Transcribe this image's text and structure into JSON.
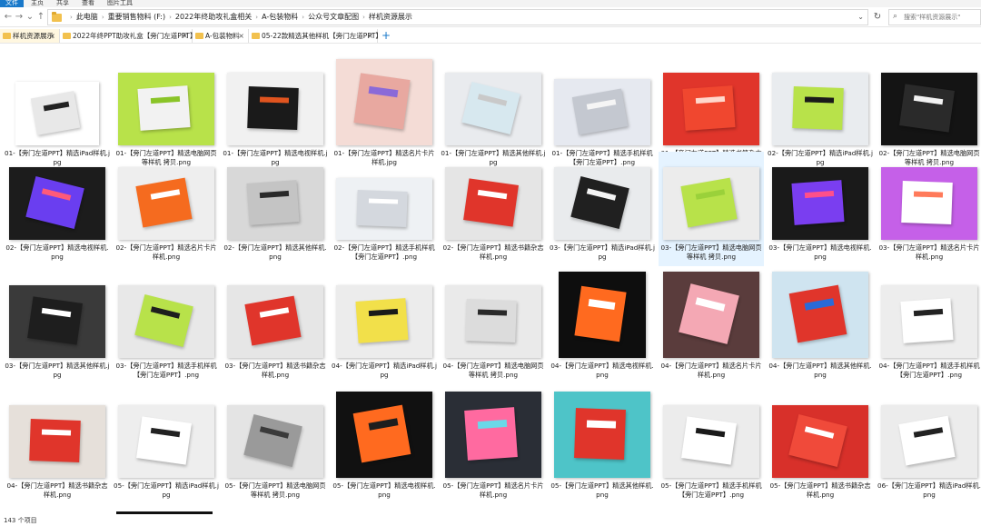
{
  "ribbon": {
    "tabs": [
      "文件",
      "主页",
      "共享",
      "查看",
      "图片工具"
    ]
  },
  "address": {
    "crumbs": [
      "此电脑",
      "重要销售物料 (F:)",
      "2022年终助攻礼盒相关",
      "A-包装物料",
      "公众号文章配图",
      "样机资源展示"
    ],
    "nav_back": "←",
    "nav_forward": "→",
    "nav_recent": "⌄",
    "nav_up": "↑",
    "dropdown": "⌄",
    "refresh": "↻"
  },
  "search": {
    "placeholder": "搜索\"样机资源展示\"",
    "value": ""
  },
  "tabs": [
    {
      "label": "样机资源展示",
      "close": "×"
    },
    {
      "label": "2022年终PPT助攻礼盒【旁门左道PPT】",
      "close": "×"
    },
    {
      "label": "A-包装物料",
      "close": "×"
    },
    {
      "label": "05-22款精选其他样机【旁门左道PPT】",
      "close": "×"
    }
  ],
  "tab_add": "+",
  "files": [
    {
      "name": "01-【旁门左道PPT】精选iPad样机.jpg",
      "bg": "#ffffff",
      "a": "#e8e8e8",
      "b": "#222222",
      "w": 92,
      "h": 70,
      "sel": false
    },
    {
      "name": "01-【旁门左道PPT】精选电脑网页等样机 拷贝.png",
      "bg": "#b8e24a",
      "a": "#f2f2f2",
      "b": "#8ac428",
      "w": 106,
      "h": 80,
      "sel": false
    },
    {
      "name": "01-【旁门左道PPT】精选电视样机.jpg",
      "bg": "#f1f1f1",
      "a": "#1a1a1a",
      "b": "#e0541f",
      "w": 106,
      "h": 80,
      "sel": false
    },
    {
      "name": "01-【旁门左道PPT】精选名片卡片样机.jpg",
      "bg": "#f4dcd6",
      "a": "#e8a8a0",
      "b": "#8a6ad8",
      "w": 106,
      "h": 95,
      "sel": false
    },
    {
      "name": "01-【旁门左道PPT】精选其他样机.jpg",
      "bg": "#e9ebee",
      "a": "#d7e8ef",
      "b": "#c9c9c9",
      "w": 106,
      "h": 80,
      "sel": false
    },
    {
      "name": "01-【旁门左道PPT】精选手机样机【旁门左道PPT】.png",
      "bg": "#e6e9f0",
      "a": "#c4c8d0",
      "b": "#f5f5f5",
      "w": 106,
      "h": 73,
      "sel": false
    },
    {
      "name": "01-【旁门左道PPT】精选书籍杂志样机.png",
      "bg": "#e0352b",
      "a": "#f0472f",
      "b": "#ffd8cc",
      "w": 106,
      "h": 80,
      "sel": false
    },
    {
      "name": "02-【旁门左道PPT】精选iPad样机.jpg",
      "bg": "#e9ecef",
      "a": "#b8e24a",
      "b": "#1a1a1a",
      "w": 106,
      "h": 80,
      "sel": false
    },
    {
      "name": "02-【旁门左道PPT】精选电脑网页等样机 拷贝.png",
      "bg": "#141414",
      "a": "#2a2a2a",
      "b": "#f2f2f2",
      "w": 106,
      "h": 80,
      "sel": false
    },
    {
      "name": "02-【旁门左道PPT】精选电视样机.png",
      "bg": "#1c1c1c",
      "a": "#6a3ef0",
      "b": "#ff5a7a",
      "w": 106,
      "h": 80,
      "sel": false
    },
    {
      "name": "02-【旁门左道PPT】精选名片卡片样机.png",
      "bg": "#eeeeee",
      "a": "#f56b1f",
      "b": "#ffffff",
      "w": 106,
      "h": 80,
      "sel": false
    },
    {
      "name": "02-【旁门左道PPT】精选其他样机.png",
      "bg": "#d8d8d8",
      "a": "#c4c4c4",
      "b": "#2a2a2a",
      "w": 106,
      "h": 80,
      "sel": false
    },
    {
      "name": "02-【旁门左道PPT】精选手机样机【旁门左道PPT】.png",
      "bg": "#eef1f4",
      "a": "#d4d8de",
      "b": "#ffffff",
      "w": 106,
      "h": 68,
      "sel": false
    },
    {
      "name": "02-【旁门左道PPT】精选书籍杂志样机.png",
      "bg": "#e5e5e5",
      "a": "#e0352b",
      "b": "#ffffff",
      "w": 106,
      "h": 80,
      "sel": false
    },
    {
      "name": "03-【旁门左道PPT】精选iPad样机.jpg",
      "bg": "#e9ebed",
      "a": "#202020",
      "b": "#f4f4f4",
      "w": 106,
      "h": 80,
      "sel": false
    },
    {
      "name": "03-【旁门左道PPT】精选电脑网页等样机 拷贝.png",
      "bg": "#ececec",
      "a": "#b8e24a",
      "b": "#9ad13a",
      "w": 106,
      "h": 80,
      "sel": true
    },
    {
      "name": "03-【旁门左道PPT】精选电视样机.png",
      "bg": "#1a1a1a",
      "a": "#7a3ef0",
      "b": "#ff4f8a",
      "w": 106,
      "h": 80,
      "sel": false
    },
    {
      "name": "03-【旁门左道PPT】精选名片卡片样机.png",
      "bg": "#c560e8",
      "a": "#ffffff",
      "b": "#ff7a5a",
      "w": 106,
      "h": 80,
      "sel": false
    },
    {
      "name": "03-【旁门左道PPT】精选其他样机.jpg",
      "bg": "#3a3a3a",
      "a": "#1e1e1e",
      "b": "#ffffff",
      "w": 106,
      "h": 80,
      "sel": false
    },
    {
      "name": "03-【旁门左道PPT】精选手机样机【旁门左道PPT】.png",
      "bg": "#e8e8e8",
      "a": "#b8e24a",
      "b": "#1e1e1e",
      "w": 106,
      "h": 80,
      "sel": false
    },
    {
      "name": "03-【旁门左道PPT】精选书籍杂志样机.png",
      "bg": "#e6e6e6",
      "a": "#e0352b",
      "b": "#ffffff",
      "w": 106,
      "h": 80,
      "sel": false
    },
    {
      "name": "04-【旁门左道PPT】精选iPad样机.jpg",
      "bg": "#ececec",
      "a": "#f2e04a",
      "b": "#1a1a1a",
      "w": 106,
      "h": 80,
      "sel": false
    },
    {
      "name": "04-【旁门左道PPT】精选电脑网页等样机 拷贝.png",
      "bg": "#eaeaea",
      "a": "#dcdcdc",
      "b": "#2a2a2a",
      "w": 106,
      "h": 80,
      "sel": false
    },
    {
      "name": "04-【旁门左道PPT】精选电视样机.png",
      "bg": "#0e0e0e",
      "a": "#ff6a1f",
      "b": "#ffffff",
      "w": 96,
      "h": 95,
      "sel": false
    },
    {
      "name": "04-【旁门左道PPT】精选名片卡片样机.png",
      "bg": "#5a3c3c",
      "a": "#f4a8b4",
      "b": "#ffffff",
      "w": 106,
      "h": 95,
      "sel": false
    },
    {
      "name": "04-【旁门左道PPT】精选其他样机.png",
      "bg": "#cfe4f0",
      "a": "#e0352b",
      "b": "#2a6ad8",
      "w": 106,
      "h": 95,
      "sel": false
    },
    {
      "name": "04-【旁门左道PPT】精选手机样机【旁门左道PPT】.png",
      "bg": "#ededed",
      "a": "#ffffff",
      "b": "#222222",
      "w": 106,
      "h": 80,
      "sel": false
    },
    {
      "name": "04-【旁门左道PPT】精选书籍杂志样机.png",
      "bg": "#e6e0da",
      "a": "#e0352b",
      "b": "#ffffff",
      "w": 106,
      "h": 80,
      "sel": false
    },
    {
      "name": "05-【旁门左道PPT】精选iPad样机.jpg",
      "bg": "#eeeeee",
      "a": "#ffffff",
      "b": "#222222",
      "w": 106,
      "h": 80,
      "sel": false
    },
    {
      "name": "05-【旁门左道PPT】精选电脑网页等样机 拷贝.png",
      "bg": "#e4e4e4",
      "a": "#9a9a9a",
      "b": "#3a3a3a",
      "w": 106,
      "h": 80,
      "sel": false
    },
    {
      "name": "05-【旁门左道PPT】精选电视样机.png",
      "bg": "#111111",
      "a": "#ff6a1f",
      "b": "#1e1e1e",
      "w": 106,
      "h": 95,
      "sel": false
    },
    {
      "name": "05-【旁门左道PPT】精选名片卡片样机.png",
      "bg": "#2a2e36",
      "a": "#ff6aa0",
      "b": "#6ad8e8",
      "w": 106,
      "h": 95,
      "sel": false
    },
    {
      "name": "05-【旁门左道PPT】精选其他样机.png",
      "bg": "#4ec4c8",
      "a": "#e0352b",
      "b": "#ffffff",
      "w": 106,
      "h": 95,
      "sel": false
    },
    {
      "name": "05-【旁门左道PPT】精选手机样机【旁门左道PPT】.png",
      "bg": "#ececec",
      "a": "#ffffff",
      "b": "#1a1a1a",
      "w": 106,
      "h": 80,
      "sel": false
    },
    {
      "name": "05-【旁门左道PPT】精选书籍杂志样机.png",
      "bg": "#d8302a",
      "a": "#f04a3a",
      "b": "#ffffff",
      "w": 106,
      "h": 80,
      "sel": false
    },
    {
      "name": "06-【旁门左道PPT】精选iPad样机.png",
      "bg": "#ececec",
      "a": "#ffffff",
      "b": "#222222",
      "w": 106,
      "h": 80,
      "sel": false
    }
  ],
  "status": {
    "count": "143 个项目"
  }
}
